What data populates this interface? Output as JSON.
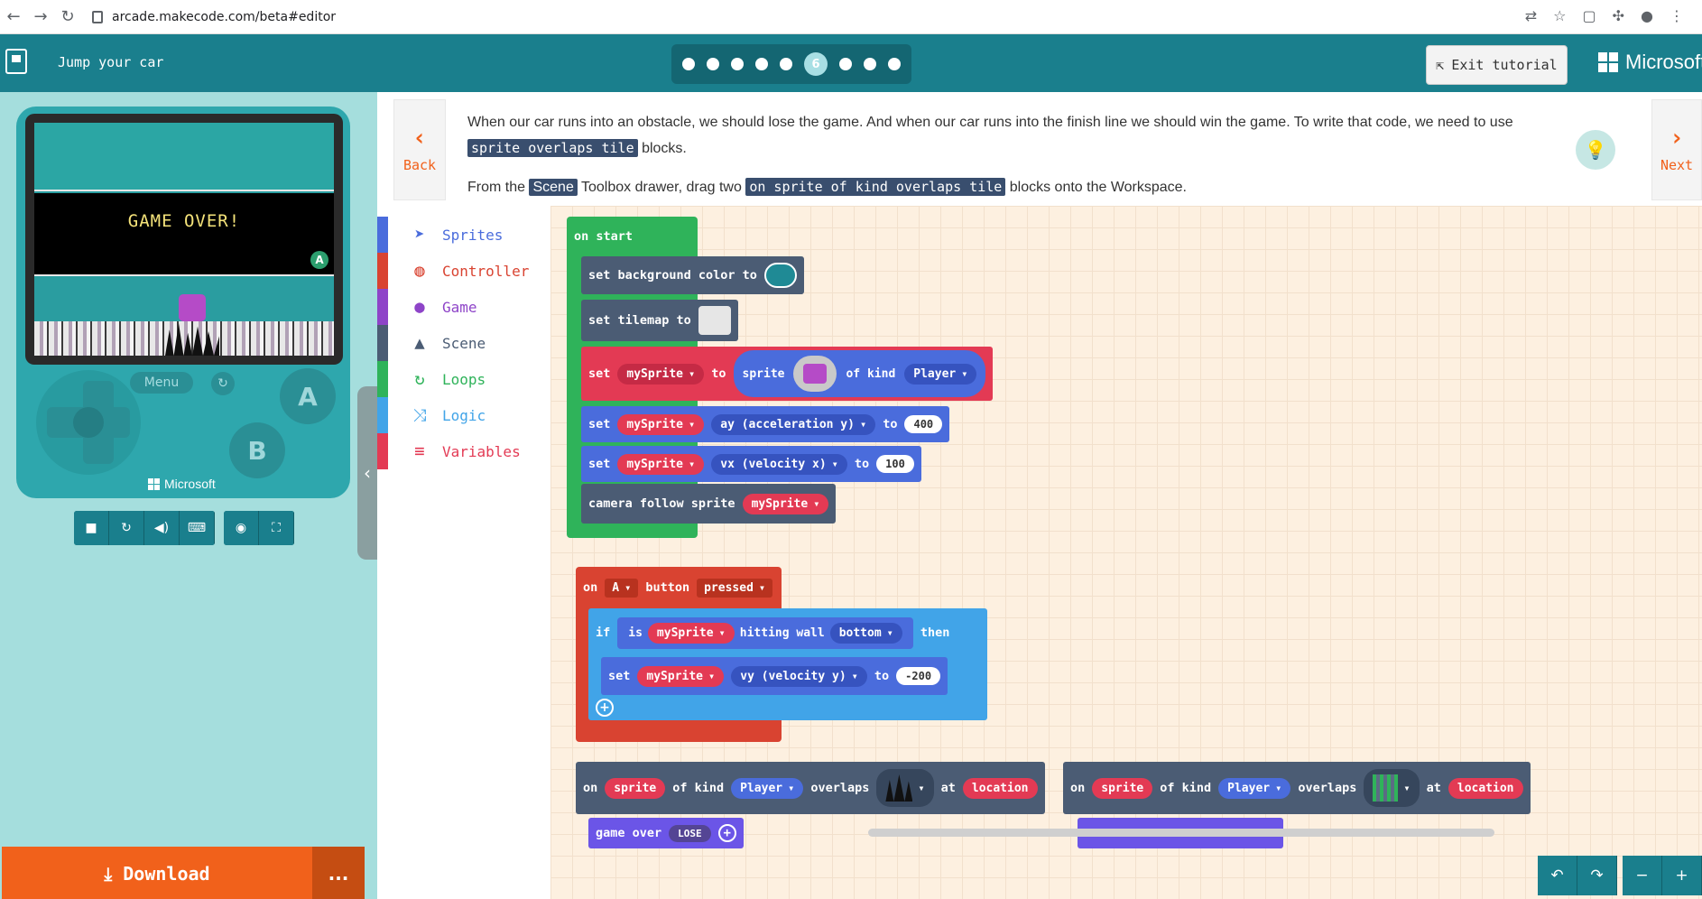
{
  "browser": {
    "url": "arcade.makecode.com/beta#editor"
  },
  "header": {
    "tutorial_title": "Jump your car",
    "active_step": "6",
    "exit_label": "Exit tutorial",
    "brand": "Microsoft"
  },
  "simulator": {
    "game_over_text": "GAME OVER!",
    "a_hint": "A",
    "menu_label": "Menu",
    "button_a": "A",
    "button_b": "B",
    "console_brand": "Microsoft"
  },
  "download": {
    "label": "Download",
    "more_label": "..."
  },
  "instruction": {
    "back_label": "Back",
    "next_label": "Next",
    "line1_prefix": "When our car runs into an obstacle, we should lose the game. And when our car runs into the finish line we should win the game. To write that code, we need to use",
    "line1_chip": "sprite overlaps tile",
    "line1_suffix": "blocks.",
    "line2_prefix": "From the",
    "line2_scene": "Scene",
    "line2_mid": "Toolbox drawer, drag two",
    "line2_chip": "on sprite of kind overlaps tile",
    "line2_suffix": "blocks onto the Workspace."
  },
  "toolbox": {
    "items": [
      {
        "label": "Sprites",
        "color": "#4a6cdc",
        "icon": "paper-plane-icon"
      },
      {
        "label": "Controller",
        "color": "#d94331",
        "icon": "gamepad-icon"
      },
      {
        "label": "Game",
        "color": "#8e44c8",
        "icon": "circle-icon"
      },
      {
        "label": "Scene",
        "color": "#4b5c74",
        "icon": "tree-icon"
      },
      {
        "label": "Loops",
        "color": "#2fb35a",
        "icon": "loop-icon"
      },
      {
        "label": "Logic",
        "color": "#41a4e8",
        "icon": "shuffle-icon"
      },
      {
        "label": "Variables",
        "color": "#e33a54",
        "icon": "list-icon"
      }
    ]
  },
  "blocks": {
    "on_start": "on start",
    "set_bg": "set background color to",
    "set_tilemap": "set tilemap to",
    "set": "set",
    "my_sprite": "mySprite",
    "to": "to",
    "sprite": "sprite",
    "of_kind": "of kind",
    "player": "Player",
    "ay": "ay (acceleration y)",
    "ay_value": "400",
    "vx": "vx (velocity x)",
    "vx_value": "100",
    "camera_follow": "camera follow sprite",
    "on": "on",
    "button_a": "A",
    "button": "button",
    "pressed": "pressed",
    "if": "if",
    "is": "is",
    "hitting_wall": "hitting wall",
    "bottom": "bottom",
    "then": "then",
    "vy": "vy (velocity y)",
    "vy_value": "-200",
    "overlaps": "overlaps",
    "at": "at",
    "location": "location",
    "game_over": "game over",
    "lose": "LOSE"
  },
  "colors": {
    "header": "#1a7f8d",
    "download": "#f1611b",
    "workspace": "#fdf0e0"
  }
}
